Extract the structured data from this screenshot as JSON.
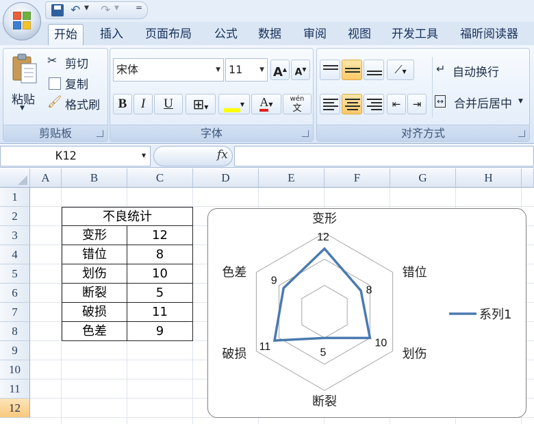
{
  "quick_access": {
    "more": "="
  },
  "tabs": [
    "开始",
    "插入",
    "页面布局",
    "公式",
    "数据",
    "审阅",
    "视图",
    "开发工具",
    "福昕阅读器"
  ],
  "clipboard": {
    "paste": "粘贴",
    "cut": "剪切",
    "copy": "复制",
    "format_painter": "格式刷",
    "label": "剪贴板"
  },
  "font": {
    "name": "宋体",
    "size": "11",
    "bold": "B",
    "italic": "I",
    "underline": "U",
    "font_color_glyph": "A",
    "phonetic": "wén",
    "label": "字体"
  },
  "alignment": {
    "wrap_text": "自动换行",
    "merge_center": "合并后居中",
    "label": "对齐方式"
  },
  "formula_bar": {
    "name_box": "K12",
    "fx": "fx",
    "formula": ""
  },
  "columns": [
    "A",
    "B",
    "C",
    "D",
    "E",
    "F",
    "G",
    "H"
  ],
  "rows": [
    "1",
    "2",
    "3",
    "4",
    "5",
    "6",
    "7",
    "8",
    "9",
    "10",
    "11",
    "12"
  ],
  "selected_row": "12",
  "sheet_table": {
    "title": "不良统计",
    "rows": [
      {
        "label": "变形",
        "value": "12"
      },
      {
        "label": "错位",
        "value": "8"
      },
      {
        "label": "划伤",
        "value": "10"
      },
      {
        "label": "断裂",
        "value": "5"
      },
      {
        "label": "破损",
        "value": "11"
      },
      {
        "label": "色差",
        "value": "9"
      }
    ]
  },
  "colors": {
    "series_line": "#4a7ab0",
    "ribbon_bg": "#dbe6f4",
    "selected_row": "#f8c87c"
  },
  "chart_data": {
    "type": "radar",
    "categories": [
      "变形",
      "错位",
      "划伤",
      "断裂",
      "破损",
      "色差"
    ],
    "series": [
      {
        "name": "系列1",
        "values": [
          12,
          8,
          10,
          5,
          11,
          9
        ]
      }
    ],
    "rlim": [
      0,
      15
    ],
    "grid": true,
    "legend": "right"
  }
}
